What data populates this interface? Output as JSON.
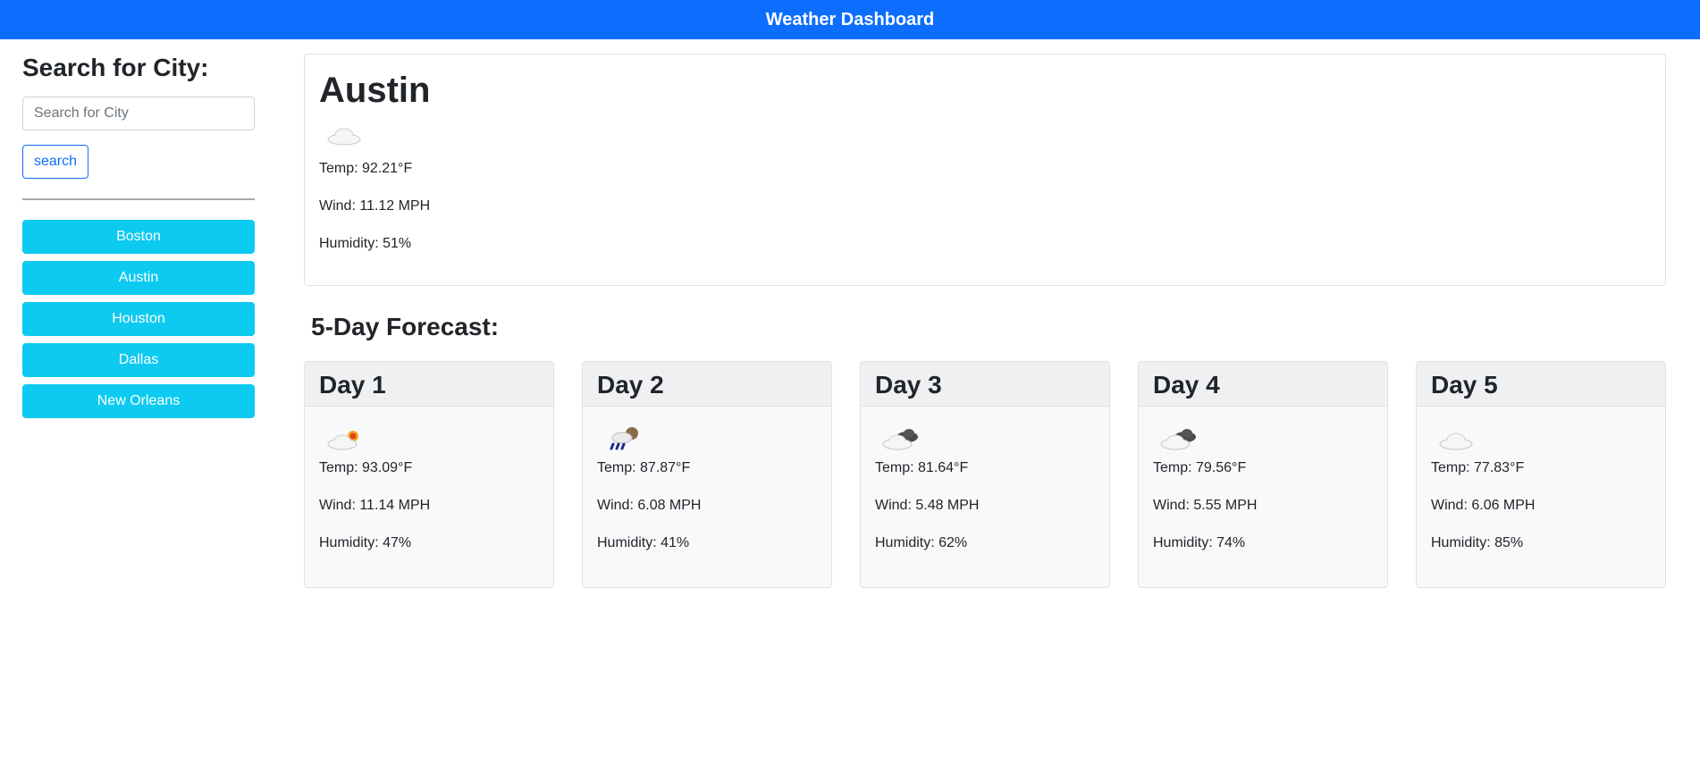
{
  "header": {
    "title": "Weather Dashboard"
  },
  "sidebar": {
    "heading": "Search for City:",
    "search_placeholder": "Search for City",
    "search_value": "",
    "search_button": "search",
    "history": [
      "Boston",
      "Austin",
      "Houston",
      "Dallas",
      "New Orleans"
    ]
  },
  "current": {
    "city": "Austin",
    "icon": "cloud-icon",
    "temp": "Temp: 92.21°F",
    "wind": "Wind: 11.12 MPH",
    "humidity": "Humidity: 51%"
  },
  "forecast": {
    "heading": "5-Day Forecast:",
    "days": [
      {
        "label": "Day 1",
        "icon": "partly-sunny-icon",
        "temp": "Temp: 93.09°F",
        "wind": "Wind: 11.14 MPH",
        "humidity": "Humidity: 47%"
      },
      {
        "label": "Day 2",
        "icon": "rain-cloud-icon",
        "temp": "Temp: 87.87°F",
        "wind": "Wind: 6.08 MPH",
        "humidity": "Humidity: 41%"
      },
      {
        "label": "Day 3",
        "icon": "overcast-icon",
        "temp": "Temp: 81.64°F",
        "wind": "Wind: 5.48 MPH",
        "humidity": "Humidity: 62%"
      },
      {
        "label": "Day 4",
        "icon": "overcast-icon",
        "temp": "Temp: 79.56°F",
        "wind": "Wind: 5.55 MPH",
        "humidity": "Humidity: 74%"
      },
      {
        "label": "Day 5",
        "icon": "cloud-icon",
        "temp": "Temp: 77.83°F",
        "wind": "Wind: 6.06 MPH",
        "humidity": "Humidity: 85%"
      }
    ]
  },
  "colors": {
    "header_bg": "#0d6efd",
    "history_button_bg": "#0dcaf0",
    "search_button_border": "#0d6efd"
  }
}
